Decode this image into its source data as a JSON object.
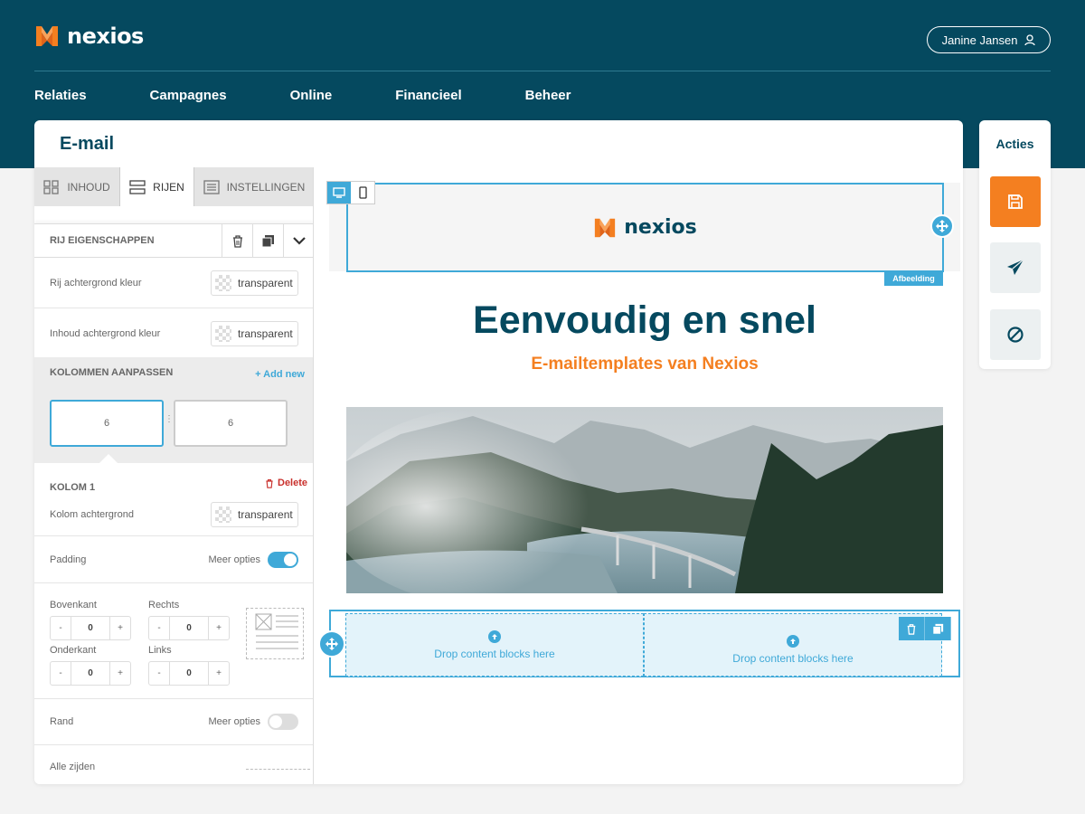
{
  "brand": {
    "name": "nexios",
    "color_primary": "#05495f",
    "color_accent": "#f47f20",
    "color_highlight": "#3fa9d8"
  },
  "user": {
    "name": "Janine Jansen",
    "icon": "user-icon"
  },
  "nav": [
    "Relaties",
    "Campagnes",
    "Online",
    "Financieel",
    "Beheer"
  ],
  "page": {
    "title": "E-mail"
  },
  "tabs": [
    {
      "label": "INHOUD",
      "icon": "grid-icon"
    },
    {
      "label": "RIJEN",
      "icon": "rows-icon"
    },
    {
      "label": "INSTELLINGEN",
      "icon": "settings-list-icon"
    }
  ],
  "row_properties": {
    "title": "RIJ EIGENSCHAPPEN",
    "row_bg_label": "Rij achtergrond kleur",
    "row_bg_value": "transparent",
    "content_bg_label": "Inhoud achtergrond kleur",
    "content_bg_value": "transparent"
  },
  "columns": {
    "title": "KOLOMMEN AANPASSEN",
    "add_new": "Add new",
    "widths": [
      "6",
      "6"
    ]
  },
  "column1": {
    "title": "KOLOM 1",
    "delete_label": "Delete",
    "bg_label": "Kolom achtergrond",
    "bg_value": "transparent"
  },
  "padding": {
    "label": "Padding",
    "more_options": "Meer opties",
    "more_options_on": true,
    "top_label": "Bovenkant",
    "top_value": "0",
    "right_label": "Rechts",
    "right_value": "0",
    "bottom_label": "Onderkant",
    "bottom_value": "0",
    "left_label": "Links",
    "left_value": "0",
    "minus": "-",
    "plus": "+"
  },
  "border": {
    "label": "Rand",
    "more_options": "Meer opties",
    "more_options_on": false,
    "all_sides_label": "Alle zijden"
  },
  "canvas": {
    "image_block_label": "Afbeelding",
    "headline": "Eenvoudig en snel",
    "subline": "E-mailtemplates van Nexios",
    "drop_text_1": "Drop content blocks here",
    "drop_text_2": "Drop content blocks here"
  },
  "actions": {
    "title": "Acties",
    "buttons": [
      "save-icon",
      "send-icon",
      "cancel-icon"
    ]
  }
}
